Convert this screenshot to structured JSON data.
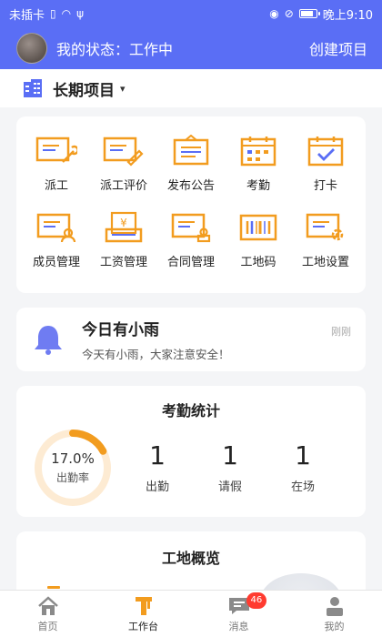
{
  "status_bar": {
    "carrier": "未插卡",
    "time_label": "晚上9:10",
    "battery_level": 0.85
  },
  "header": {
    "status_text": "我的状态：工作中",
    "create_label": "创建项目"
  },
  "project": {
    "name": "长期项目"
  },
  "functions": [
    {
      "label": "派工",
      "icon": "dispatch-icon"
    },
    {
      "label": "派工评价",
      "icon": "dispatch-review-icon"
    },
    {
      "label": "发布公告",
      "icon": "announcement-icon"
    },
    {
      "label": "考勤",
      "icon": "calendar-icon"
    },
    {
      "label": "打卡",
      "icon": "checkin-icon"
    },
    {
      "label": "成员管理",
      "icon": "member-management-icon"
    },
    {
      "label": "工资管理",
      "icon": "salary-icon"
    },
    {
      "label": "合同管理",
      "icon": "contract-icon"
    },
    {
      "label": "工地码",
      "icon": "barcode-icon"
    },
    {
      "label": "工地设置",
      "icon": "site-settings-icon"
    }
  ],
  "notice": {
    "title": "今日有小雨",
    "body": "今天有小雨，大家注意安全！",
    "time": "刚刚"
  },
  "attendance": {
    "title": "考勤统计",
    "rate_text": "17.0%",
    "rate_value": 0.17,
    "rate_label": "出勤率",
    "stats": [
      {
        "value": "1",
        "label": "出勤"
      },
      {
        "value": "1",
        "label": "请假"
      },
      {
        "value": "1",
        "label": "在场"
      }
    ]
  },
  "site": {
    "title": "工地概览"
  },
  "tabbar": {
    "active": 1,
    "items": [
      {
        "label": "首页",
        "icon": "home-icon"
      },
      {
        "label": "工作台",
        "icon": "workbench-icon"
      },
      {
        "label": "消息",
        "icon": "message-icon",
        "badge": "46"
      },
      {
        "label": "我的",
        "icon": "profile-icon"
      }
    ]
  },
  "colors": {
    "primary": "#5a6ef5",
    "accent": "#f29c1f",
    "bell": "#6f7cf2",
    "badge": "#ff3b30"
  }
}
